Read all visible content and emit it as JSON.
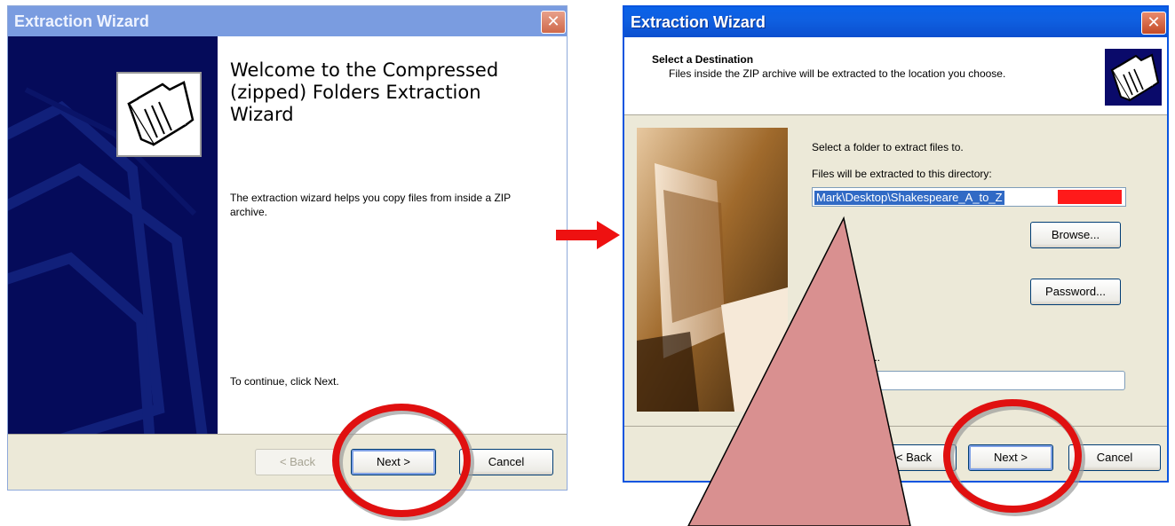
{
  "left_window": {
    "title": "Extraction Wizard",
    "close": "✕",
    "heading": "Welcome to the Compressed (zipped) Folders Extraction Wizard",
    "body": "The extraction wizard helps you copy files from inside a ZIP archive.",
    "continue_text": "To continue, click Next.",
    "buttons": {
      "back": "< Back",
      "next": "Next >",
      "cancel": "Cancel"
    }
  },
  "right_window": {
    "title": "Extraction Wizard",
    "close": "✕",
    "header_title": "Select a Destination",
    "header_desc": "Files inside the ZIP archive will be extracted to the location you choose.",
    "select_label": "Select a folder to extract files to.",
    "dir_label": "Files will be extracted to this directory:",
    "path_value": "Mark\\Desktop\\Shakespeare_A_to_Z",
    "browse": "Browse...",
    "password": "Password...",
    "progress_dots": "...",
    "buttons": {
      "back": "< Back",
      "next": "Next >",
      "cancel": "Cancel"
    }
  },
  "annotation_colors": {
    "arrow": "#ee1111",
    "circle": "#e01010",
    "callout": "#d99090"
  }
}
